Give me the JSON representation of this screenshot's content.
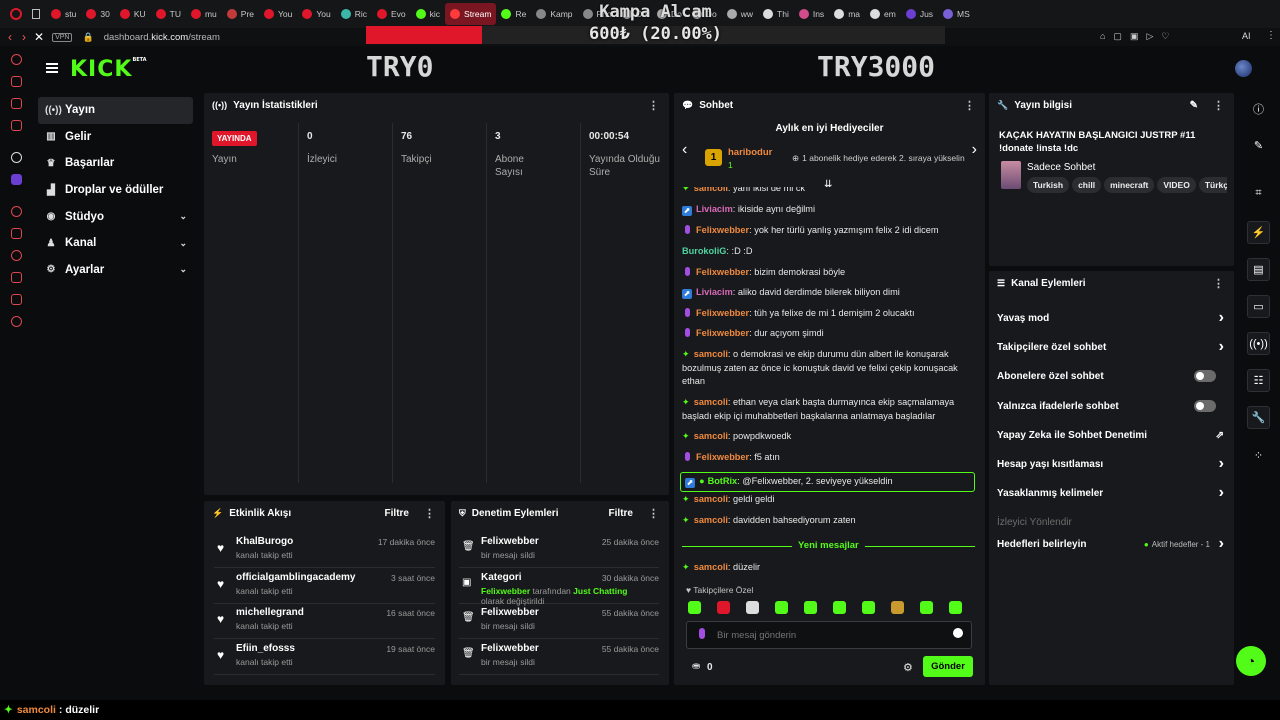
{
  "browser": {
    "tabs": [
      "stu",
      "30",
      "KU",
      "TU",
      "mu",
      "Pre",
      "You",
      "You",
      "Ric",
      "Evo",
      "kic",
      "Stream",
      "Re",
      "Kamp",
      "Pho",
      "Öd",
      "Do",
      "Do",
      "ww",
      "Thi",
      "Ins",
      "ma",
      "em",
      "Jus",
      "MS"
    ],
    "active_tab": "Stream",
    "url_prefix": "dashboard.",
    "url_domain": "kick.com",
    "url_path": "/stream",
    "vpn": "VPN",
    "ext_ai": "AI"
  },
  "overlay": {
    "title": "Kampa Alcam",
    "percent_text": "600₺ (20.00%)",
    "progress": 0.2,
    "left_label": "TRY0",
    "right_label": "TRY3000"
  },
  "logo": {
    "text": "KICK",
    "beta": "BETA"
  },
  "sidebar": {
    "items": [
      {
        "label": "Yayın",
        "icon": "broadcast-icon",
        "active": true
      },
      {
        "label": "Gelir",
        "icon": "bank-icon"
      },
      {
        "label": "Başarılar",
        "icon": "trophy-icon"
      },
      {
        "label": "Droplar ve ödüller",
        "icon": "drops-icon"
      },
      {
        "label": "Stüdyo",
        "icon": "studio-icon",
        "expandable": true
      },
      {
        "label": "Kanal",
        "icon": "channel-icon",
        "expandable": true
      },
      {
        "label": "Ayarlar",
        "icon": "gear-icon",
        "expandable": true
      }
    ]
  },
  "stats": {
    "title": "Yayın İstatistikleri",
    "live_badge": "YAYINDA",
    "live_label": "Yayın",
    "items": [
      {
        "value": "0",
        "label": "İzleyici"
      },
      {
        "value": "76",
        "label": "Takipçi"
      },
      {
        "value": "3",
        "label": "Abone Sayısı"
      },
      {
        "value": "00:00:54",
        "label": "Yayında Olduğu Süre"
      }
    ]
  },
  "activity": {
    "title": "Etkinlik Akışı",
    "filter": "Filtre",
    "items": [
      {
        "name": "KhalBurogo",
        "sub": "kanalı takip etti",
        "time": "17 dakika önce"
      },
      {
        "name": "officialgamblingacademy",
        "sub": "kanalı takip etti",
        "time": "3 saat önce"
      },
      {
        "name": "michellegrand",
        "sub": "kanalı takip etti",
        "time": "16 saat önce"
      },
      {
        "name": "Efiin_efosss",
        "sub": "kanalı takip etti",
        "time": "19 saat önce"
      }
    ]
  },
  "moderation": {
    "title": "Denetim Eylemleri",
    "filter": "Filtre",
    "items": [
      {
        "name": "Felixwebber",
        "sub": "bir mesajı sildi",
        "time": "25 dakika önce"
      },
      {
        "name": "Kategori",
        "sub_user": "Felixwebber",
        "sub_mid": " tarafından ",
        "sub_cat": "Just Chatting",
        "sub_end": " olarak değiştirildi",
        "time": "30 dakika önce"
      },
      {
        "name": "Felixwebber",
        "sub": "bir mesajı sildi",
        "time": "55 dakika önce"
      },
      {
        "name": "Felixwebber",
        "sub": "bir mesajı sildi",
        "time": "55 dakika önce"
      }
    ]
  },
  "chat": {
    "title": "Sohbet",
    "gifters_title": "Aylık en iyi Hediyeciler",
    "top_gifter": "haribodur",
    "top_gifter_count": "1",
    "gifter_hint": "1 abonelik hediye ederek 2. sıraya yükselin",
    "messages": [
      {
        "user": "samcoli",
        "color": "#f08a3e",
        "badge": "lightning",
        "text": "yanı ikisi de mi ck"
      },
      {
        "user": "Liviacim",
        "color": "#d86ab8",
        "badge": "sub",
        "text": "ikiside aynı değilmi"
      },
      {
        "user": "Felixwebber",
        "color": "#f08a3e",
        "badge": "mod",
        "text": "yok her türlü yanlış yazmışım felix 2 idi dicem"
      },
      {
        "user": "BurokoliG",
        "color": "#4fd3a0",
        "badge": "",
        "text": ":D :D"
      },
      {
        "user": "Felixwebber",
        "color": "#f08a3e",
        "badge": "mod",
        "text": "bizim demokrasi böyle"
      },
      {
        "user": "Liviacim",
        "color": "#d86ab8",
        "badge": "sub",
        "text": "aliko david derdimde bilerek biliyon dimi"
      },
      {
        "user": "Felixwebber",
        "color": "#f08a3e",
        "badge": "mod",
        "text": "tüh ya felixe de mi 1 demişim 2 olucaktı"
      },
      {
        "user": "Felixwebber",
        "color": "#f08a3e",
        "badge": "mod",
        "text": "dur açıyom şimdi"
      },
      {
        "user": "samcoli",
        "color": "#f08a3e",
        "badge": "lightning",
        "text": "o demokrasi ve ekip durumu dün albert ile konuşarak bozulmuş zaten az önce ic konuştuk david ve felixi çekip konuşacak ethan"
      },
      {
        "user": "samcoli",
        "color": "#f08a3e",
        "badge": "lightning",
        "text": "ethan veya clark başta durmayınca ekip saçmalamaya başladı ekip içi muhabbetleri başkalarına anlatmaya başladılar"
      },
      {
        "user": "samcoli",
        "color": "#f08a3e",
        "badge": "lightning",
        "text": "powpdkwoedk"
      },
      {
        "user": "Felixwebber",
        "color": "#f08a3e",
        "badge": "mod",
        "text": "f5 atın"
      },
      {
        "user": "BotRix",
        "color": "#53fc18",
        "badge": "bot",
        "text": "@Felixwebber, 2. seviyeye yükseldin",
        "highlight": true
      },
      {
        "user": "samcoli",
        "color": "#f08a3e",
        "badge": "lightning",
        "text": "geldi geldi"
      },
      {
        "user": "samcoli",
        "color": "#f08a3e",
        "badge": "lightning",
        "text": "davidden bahsediyorum zaten"
      }
    ],
    "new_messages_label": "Yeni mesajlar",
    "after_new": {
      "user": "samcoli",
      "color": "#f08a3e",
      "badge": "lightning",
      "text": "düzelir"
    },
    "followers_only": "Takipçilere Özel",
    "input_placeholder": "Bir mesaj gönderin",
    "points": "0",
    "send": "Gönder"
  },
  "stream_info": {
    "title": "Yayın bilgisi",
    "stream_title": "KAÇAK HAYATIN BAŞLANGICI JUSTRP #11 !donate !insta !dc",
    "category": "Sadece Sohbet",
    "tags": [
      "Turkish",
      "chill",
      "minecraft",
      "VIDEO",
      "Türkç"
    ]
  },
  "channel_actions": {
    "title": "Kanal Eylemleri",
    "items": [
      {
        "label": "Yavaş mod",
        "type": "chevron"
      },
      {
        "label": "Takipçilere özel sohbet",
        "type": "chevron"
      },
      {
        "label": "Abonelere özel sohbet",
        "type": "toggle"
      },
      {
        "label": "Yalnızca ifadelerle sohbet",
        "type": "toggle"
      },
      {
        "label": "Yapay Zeka ile Sohbet Denetimi",
        "type": "external"
      },
      {
        "label": "Hesap yaşı kısıtlaması",
        "type": "chevron"
      },
      {
        "label": "Yasaklanmış kelimeler",
        "type": "chevron"
      },
      {
        "label": "İzleyici Yönlendir",
        "type": "disabled"
      },
      {
        "label": "Hedefleri belirleyin",
        "type": "chevron",
        "extra": "Aktif hedefler - 1"
      }
    ]
  },
  "bottom_ticker": {
    "user": "samcoli",
    "text": ": düzelir"
  },
  "colors": {
    "accent": "#53fc18",
    "live": "#e0162b",
    "panel": "#18191c"
  }
}
